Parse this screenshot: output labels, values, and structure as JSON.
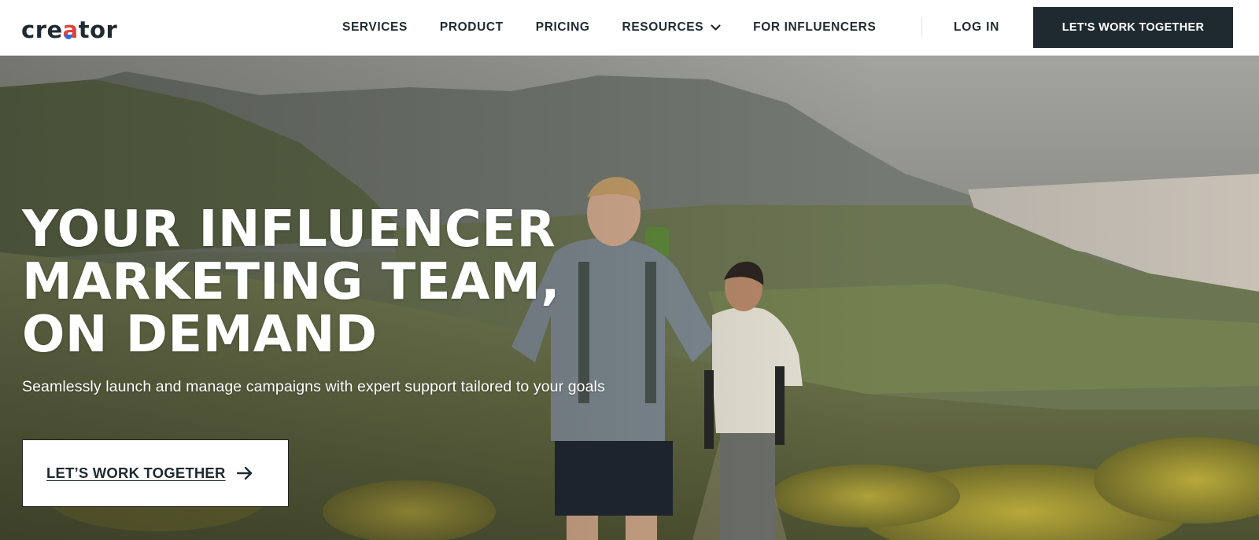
{
  "brand": {
    "logo_text_1": "cre",
    "logo_text_2": "a",
    "logo_text_3": "tor",
    "accent_red": "#e0413d",
    "accent_blue": "#2f6bd8",
    "dark": "#1f2a30"
  },
  "nav": {
    "items": [
      {
        "label": "SERVICES"
      },
      {
        "label": "PRODUCT"
      },
      {
        "label": "PRICING"
      },
      {
        "label": "RESOURCES",
        "icon": "chevron-down-icon"
      },
      {
        "label": "FOR INFLUENCERS"
      }
    ],
    "login_label": "LOG IN",
    "cta_label": "LET'S WORK TOGETHER"
  },
  "hero": {
    "headline_lines": [
      "YOUR INFLUENCER",
      "MARKETING TEAM,",
      "ON DEMAND"
    ],
    "subheadline": "Seamlessly launch and manage campaigns with expert support tailored to your goals",
    "cta_label": "LET’S WORK TOGETHER",
    "cta_icon": "arrow-right-icon",
    "background": "hikers-on-mountain-photo"
  }
}
